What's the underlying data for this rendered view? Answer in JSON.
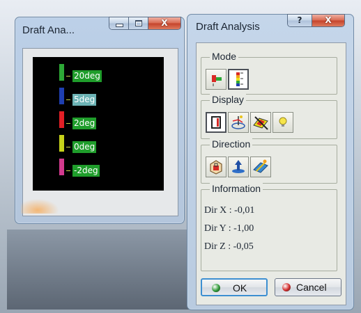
{
  "left_window": {
    "title": "Draft Ana...",
    "legend": [
      {
        "color": "#2da836",
        "label": "20deg"
      },
      {
        "color": "#1f3fb0",
        "label": "5deg"
      },
      {
        "color": "#e21f26",
        "label": "2deg"
      },
      {
        "color": "#c6d21a",
        "label": "0deg"
      },
      {
        "color": "#d23a8e",
        "label": "-2deg"
      }
    ]
  },
  "right_window": {
    "title": "Draft Analysis",
    "help_glyph": "?",
    "close_glyph": "X",
    "mode": {
      "title": "Mode",
      "tools": [
        {
          "icon": "draft-mode-simple-icon",
          "pressed": false
        },
        {
          "icon": "draft-mode-full-icon",
          "pressed": true
        }
      ]
    },
    "display": {
      "title": "Display",
      "tools": [
        {
          "icon": "color-scale-icon",
          "pressed": true
        },
        {
          "icon": "on-the-fly-icon",
          "pressed": false
        },
        {
          "icon": "crossed-color-icon",
          "pressed": false
        },
        {
          "icon": "light-bulb-icon",
          "pressed": false
        }
      ]
    },
    "direction": {
      "title": "Direction",
      "tools": [
        {
          "icon": "lock-direction-icon",
          "pressed": false
        },
        {
          "icon": "direction-arrow-icon",
          "pressed": false
        },
        {
          "icon": "compass-direction-icon",
          "pressed": false
        }
      ]
    },
    "information": {
      "title": "Information",
      "lines": [
        "Dir X : -0,01",
        "Dir Y : -1,00",
        "Dir Z : -0,05"
      ]
    },
    "ok_label": "OK",
    "cancel_label": "Cancel"
  },
  "colors": {
    "ok_dot": "#2e9a37",
    "cancel_dot": "#d22a2a",
    "label_bg": "#1f9d2b",
    "label_bg_selected": "#6cb3b5"
  }
}
